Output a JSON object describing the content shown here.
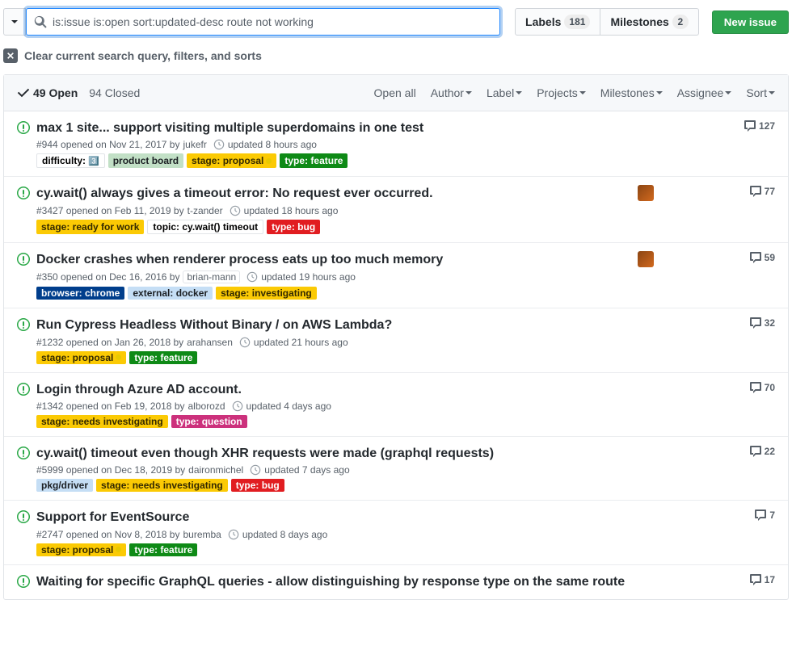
{
  "search": {
    "value": "is:issue is:open sort:updated-desc route not working "
  },
  "nav": {
    "labels_text": "Labels",
    "labels_count": "181",
    "milestones_text": "Milestones",
    "milestones_count": "2",
    "new_issue": "New issue"
  },
  "clear_text": "Clear current search query, filters, and sorts",
  "header": {
    "open": "49 Open",
    "closed": "94 Closed",
    "toolbar": [
      "Open all",
      "Author",
      "Label",
      "Projects",
      "Milestones",
      "Assignee",
      "Sort"
    ]
  },
  "label_colors": {
    "difficulty": {
      "bg": "#ffffff",
      "fg": "#000000",
      "border": "#e1e4e8"
    },
    "product_board": {
      "bg": "#c2e0c6",
      "fg": "#1b1f23"
    },
    "stage_proposal": {
      "bg": "#fbca04",
      "fg": "#332900"
    },
    "type_feature": {
      "bg": "#0e8a16",
      "fg": "#ffffff"
    },
    "stage_ready": {
      "bg": "#fbca04",
      "fg": "#332900"
    },
    "topic_wait": {
      "bg": "#ffffff",
      "fg": "#000000",
      "border": "#e1e4e8"
    },
    "type_bug": {
      "bg": "#e11d21",
      "fg": "#ffffff"
    },
    "browser_chrome": {
      "bg": "#003e8c",
      "fg": "#ffffff"
    },
    "external_docker": {
      "bg": "#c5def5",
      "fg": "#1b1f23"
    },
    "stage_investigating": {
      "bg": "#fbca04",
      "fg": "#332900"
    },
    "stage_needs_investigating": {
      "bg": "#fbca04",
      "fg": "#332900"
    },
    "type_question": {
      "bg": "#cc317c",
      "fg": "#ffffff"
    },
    "pkg_driver": {
      "bg": "#c5def5",
      "fg": "#1b1f23"
    }
  },
  "issues": [
    {
      "title": "max 1 site... support visiting multiple superdomains in one test",
      "num": "#944",
      "opened": "opened on Nov 21, 2017 by",
      "author": "jukefr",
      "author_box": false,
      "updated": "updated 8 hours ago",
      "comments": "127",
      "avatar": false,
      "labels": [
        {
          "text": "difficulty: ",
          "tile": "3",
          "key": "difficulty"
        },
        {
          "text": "product board",
          "key": "product_board"
        },
        {
          "text": "stage: proposal",
          "dot": true,
          "key": "stage_proposal"
        },
        {
          "text": "type: feature",
          "key": "type_feature"
        }
      ]
    },
    {
      "title": "cy.wait() always gives a timeout error: No request ever occurred.",
      "num": "#3427",
      "opened": "opened on Feb 11, 2019 by",
      "author": "t-zander",
      "author_box": false,
      "updated": "updated 18 hours ago",
      "comments": "77",
      "avatar": true,
      "labels": [
        {
          "text": "stage: ready for work",
          "key": "stage_ready"
        },
        {
          "text": "topic: cy.wait() timeout",
          "key": "topic_wait"
        },
        {
          "text": "type: bug",
          "key": "type_bug"
        }
      ]
    },
    {
      "title": "Docker crashes when renderer process eats up too much memory",
      "num": "#350",
      "opened": "opened on Dec 16, 2016 by",
      "author": "brian-mann",
      "author_box": true,
      "updated": "updated 19 hours ago",
      "comments": "59",
      "avatar": true,
      "labels": [
        {
          "text": "browser: chrome",
          "key": "browser_chrome"
        },
        {
          "text": "external: docker",
          "key": "external_docker"
        },
        {
          "text": "stage: investigating",
          "key": "stage_investigating"
        }
      ]
    },
    {
      "title": "Run Cypress Headless Without Binary / on AWS Lambda?",
      "num": "#1232",
      "opened": "opened on Jan 26, 2018 by",
      "author": "arahansen",
      "author_box": false,
      "updated": "updated 21 hours ago",
      "comments": "32",
      "avatar": false,
      "labels": [
        {
          "text": "stage: proposal",
          "dot": true,
          "key": "stage_proposal"
        },
        {
          "text": "type: feature",
          "key": "type_feature"
        }
      ]
    },
    {
      "title": "Login through Azure AD account.",
      "num": "#1342",
      "opened": "opened on Feb 19, 2018 by",
      "author": "alborozd",
      "author_box": false,
      "updated": "updated 4 days ago",
      "comments": "70",
      "avatar": false,
      "labels": [
        {
          "text": "stage: needs investigating",
          "key": "stage_needs_investigating"
        },
        {
          "text": "type: question",
          "key": "type_question"
        }
      ]
    },
    {
      "title": "cy.wait() timeout even though XHR requests were made (graphql requests)",
      "num": "#5999",
      "opened": "opened on Dec 18, 2019 by",
      "author": "daironmichel",
      "author_box": false,
      "updated": "updated 7 days ago",
      "comments": "22",
      "avatar": false,
      "labels": [
        {
          "text": "pkg/driver",
          "key": "pkg_driver"
        },
        {
          "text": "stage: needs investigating",
          "key": "stage_needs_investigating"
        },
        {
          "text": "type: bug",
          "key": "type_bug"
        }
      ]
    },
    {
      "title": "Support for EventSource",
      "num": "#2747",
      "opened": "opened on Nov 8, 2018 by",
      "author": "buremba",
      "author_box": false,
      "updated": "updated 8 days ago",
      "comments": "7",
      "avatar": false,
      "labels": [
        {
          "text": "stage: proposal",
          "dot": true,
          "key": "stage_proposal"
        },
        {
          "text": "type: feature",
          "key": "type_feature"
        }
      ]
    },
    {
      "title": "Waiting for specific GraphQL queries - allow distinguishing by response type on the same route",
      "num": "",
      "opened": "",
      "author": "",
      "author_box": false,
      "updated": "",
      "comments": "17",
      "avatar": false,
      "no_meta": true,
      "labels": []
    }
  ]
}
